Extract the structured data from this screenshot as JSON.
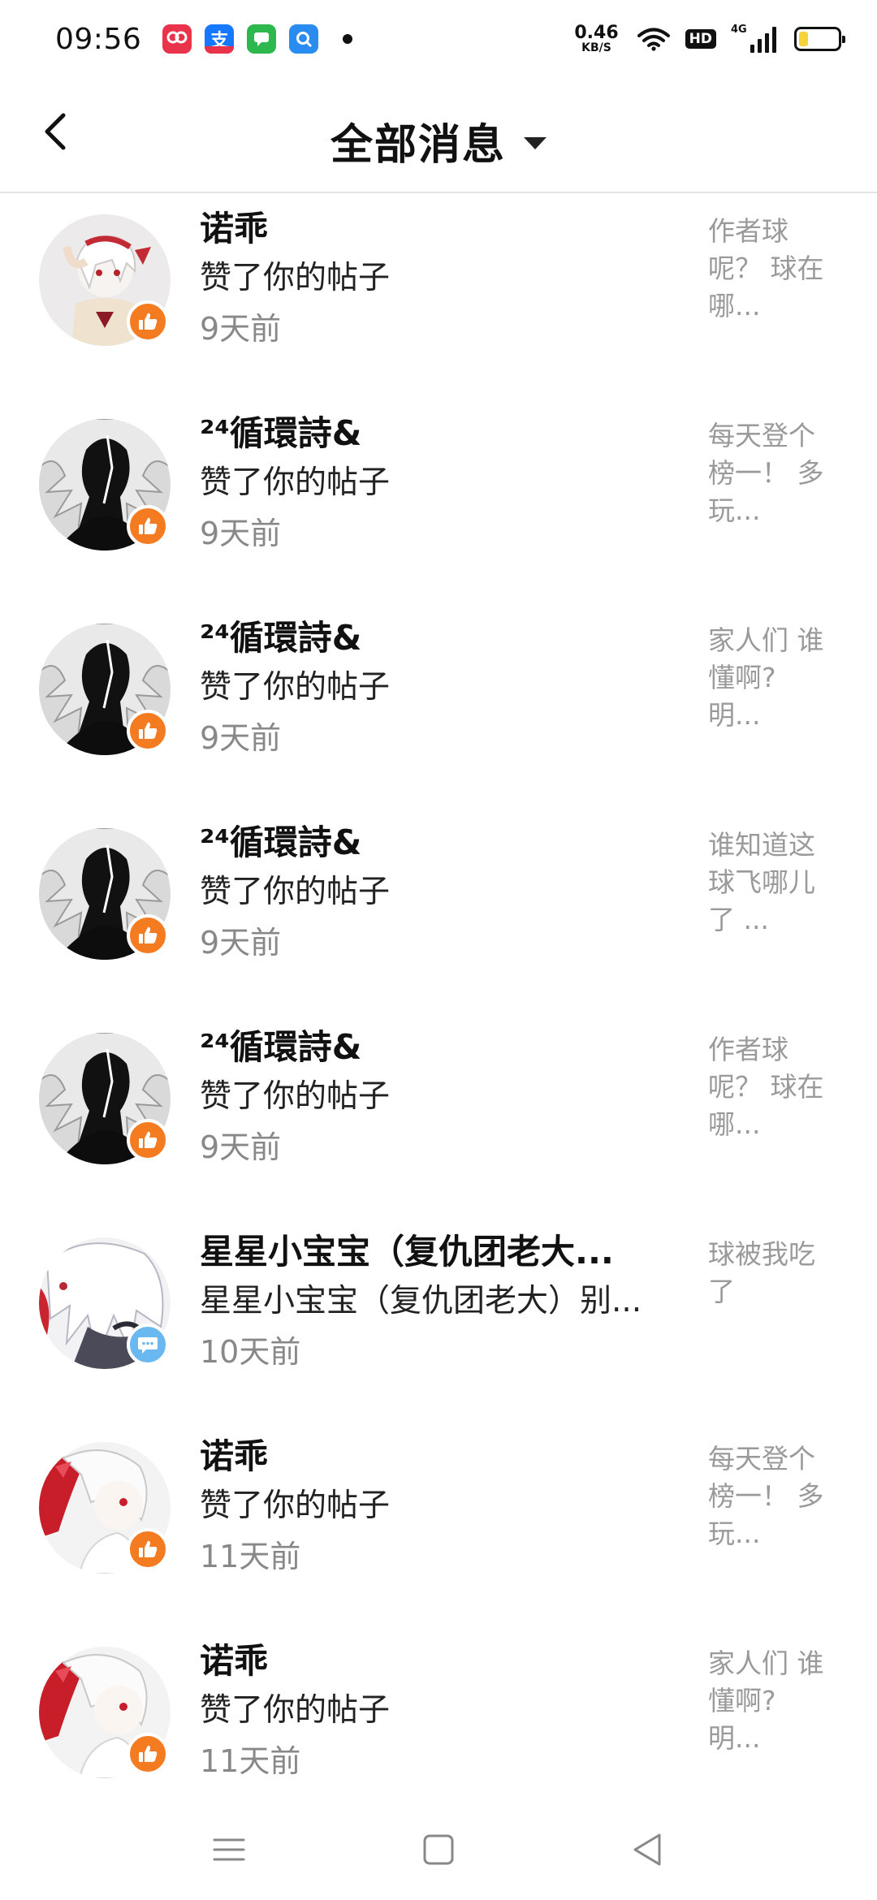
{
  "status_bar": {
    "time": "09:56",
    "net_speed_value": "0.46",
    "net_speed_unit": "KB/S",
    "hd_label": "HD",
    "signal_label": "4G",
    "battery_level": 0.24,
    "notification_icons": [
      "app-icon-1",
      "alipay-icon",
      "messages-icon",
      "search-app-icon"
    ]
  },
  "header": {
    "title": "全部消息",
    "back_icon": "chevron-left-icon",
    "dropdown_icon": "triangle-down-icon"
  },
  "messages": [
    {
      "name": "诺乖",
      "action": "赞了你的帖子",
      "time": "9天前",
      "preview": [
        "作者球",
        "呢？ 球在",
        "哪..."
      ],
      "badge": "like",
      "avatar": "a"
    },
    {
      "name": "²⁴循環詩&",
      "action": "赞了你的帖子",
      "time": "9天前",
      "preview": [
        "每天登个",
        "榜一！ 多",
        "玩..."
      ],
      "badge": "like",
      "avatar": "b"
    },
    {
      "name": "²⁴循環詩&",
      "action": "赞了你的帖子",
      "time": "9天前",
      "preview": [
        "家人们 谁",
        "懂啊?",
        "明..."
      ],
      "badge": "like",
      "avatar": "b"
    },
    {
      "name": "²⁴循環詩&",
      "action": "赞了你的帖子",
      "time": "9天前",
      "preview": [
        "谁知道这",
        "球飞哪儿",
        "了 ..."
      ],
      "badge": "like",
      "avatar": "b"
    },
    {
      "name": "²⁴循環詩&",
      "action": "赞了你的帖子",
      "time": "9天前",
      "preview": [
        "作者球",
        "呢？ 球在",
        "哪..."
      ],
      "badge": "like",
      "avatar": "b"
    },
    {
      "name": "星星小宝宝（复仇团老大...",
      "action": "星星小宝宝（复仇团老大）别...",
      "time": "10天前",
      "preview": [
        "球被我吃",
        "了"
      ],
      "badge": "comment",
      "avatar": "c"
    },
    {
      "name": "诺乖",
      "action": "赞了你的帖子",
      "time": "11天前",
      "preview": [
        "每天登个",
        "榜一！ 多",
        "玩..."
      ],
      "badge": "like",
      "avatar": "d"
    },
    {
      "name": "诺乖",
      "action": "赞了你的帖子",
      "time": "11天前",
      "preview": [
        "家人们 谁",
        "懂啊?",
        "明..."
      ],
      "badge": "like",
      "avatar": "d"
    }
  ],
  "nav_bar": {
    "menu_icon": "menu-icon",
    "home_icon": "home-square-icon",
    "back_icon": "back-triangle-icon"
  }
}
